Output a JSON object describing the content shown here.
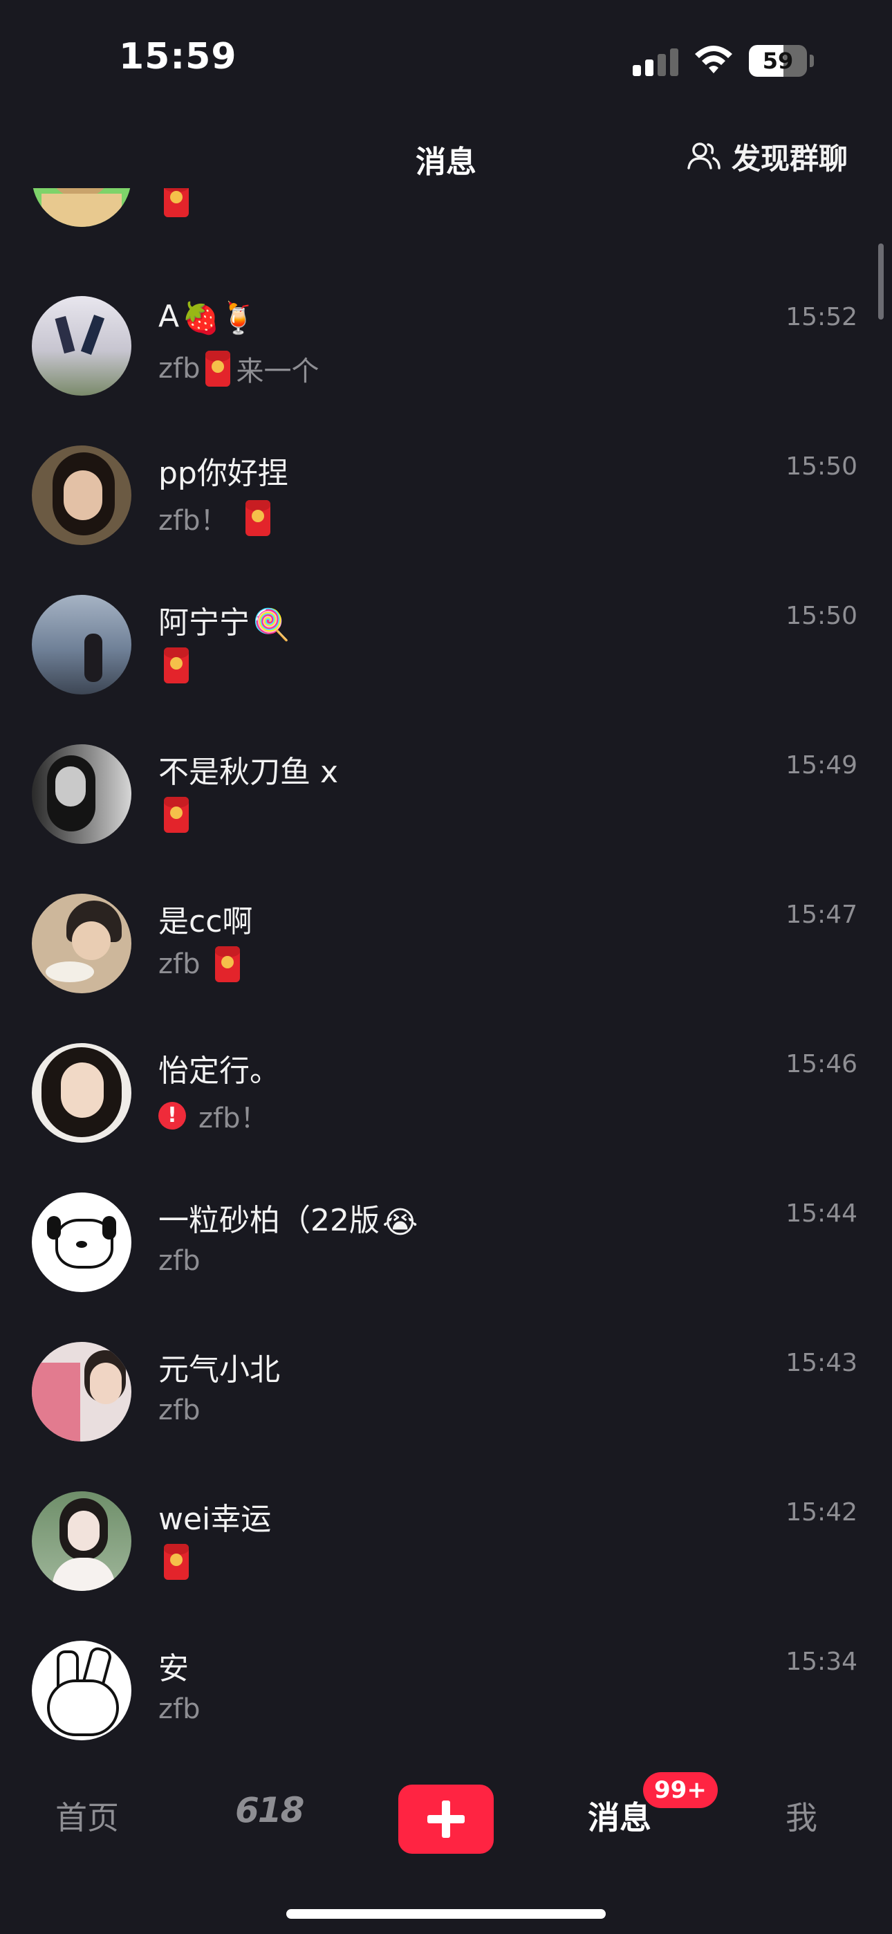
{
  "status_bar": {
    "time": "15:59",
    "battery": "59",
    "battery_level": 0.59
  },
  "header": {
    "title": "消息",
    "discover_label": "发现群聊",
    "discover_icon": "group-people-icon"
  },
  "conversations": [
    {
      "name": "",
      "preview": "",
      "time": "",
      "has_redpacket": true
    },
    {
      "name": "A",
      "name_emoji": "🍓🍹",
      "preview_prefix": "zfb",
      "preview_suffix": "来一个",
      "time": "15:52"
    },
    {
      "name": "pp你好捏",
      "preview_prefix": "zfb！",
      "time": "15:50"
    },
    {
      "name": "阿宁宁",
      "name_emoji": "🍭",
      "time": "15:50"
    },
    {
      "name": "不是秋刀鱼 x",
      "time": "15:49"
    },
    {
      "name": "是cc啊",
      "preview_prefix": "zfb",
      "time": "15:47"
    },
    {
      "name": "怡定行。",
      "alert_icon": "!",
      "preview_prefix": "zfb！",
      "time": "15:46"
    },
    {
      "name": "一粒砂柏（22版",
      "name_emoji": "😭",
      "preview_prefix": "zfb",
      "time": "15:44"
    },
    {
      "name": "元气小北",
      "preview_prefix": "zfb",
      "time": "15:43"
    },
    {
      "name": "wei幸运",
      "time": "15:42"
    },
    {
      "name": "安",
      "preview_prefix": "zfb",
      "time": "15:34"
    }
  ],
  "tabbar": {
    "home": "首页",
    "promo": "618",
    "messages": "消息",
    "messages_badge": "99+",
    "me": "我"
  },
  "colors": {
    "background": "#191920",
    "accent": "#ff2442",
    "muted": "#8e8e93"
  }
}
